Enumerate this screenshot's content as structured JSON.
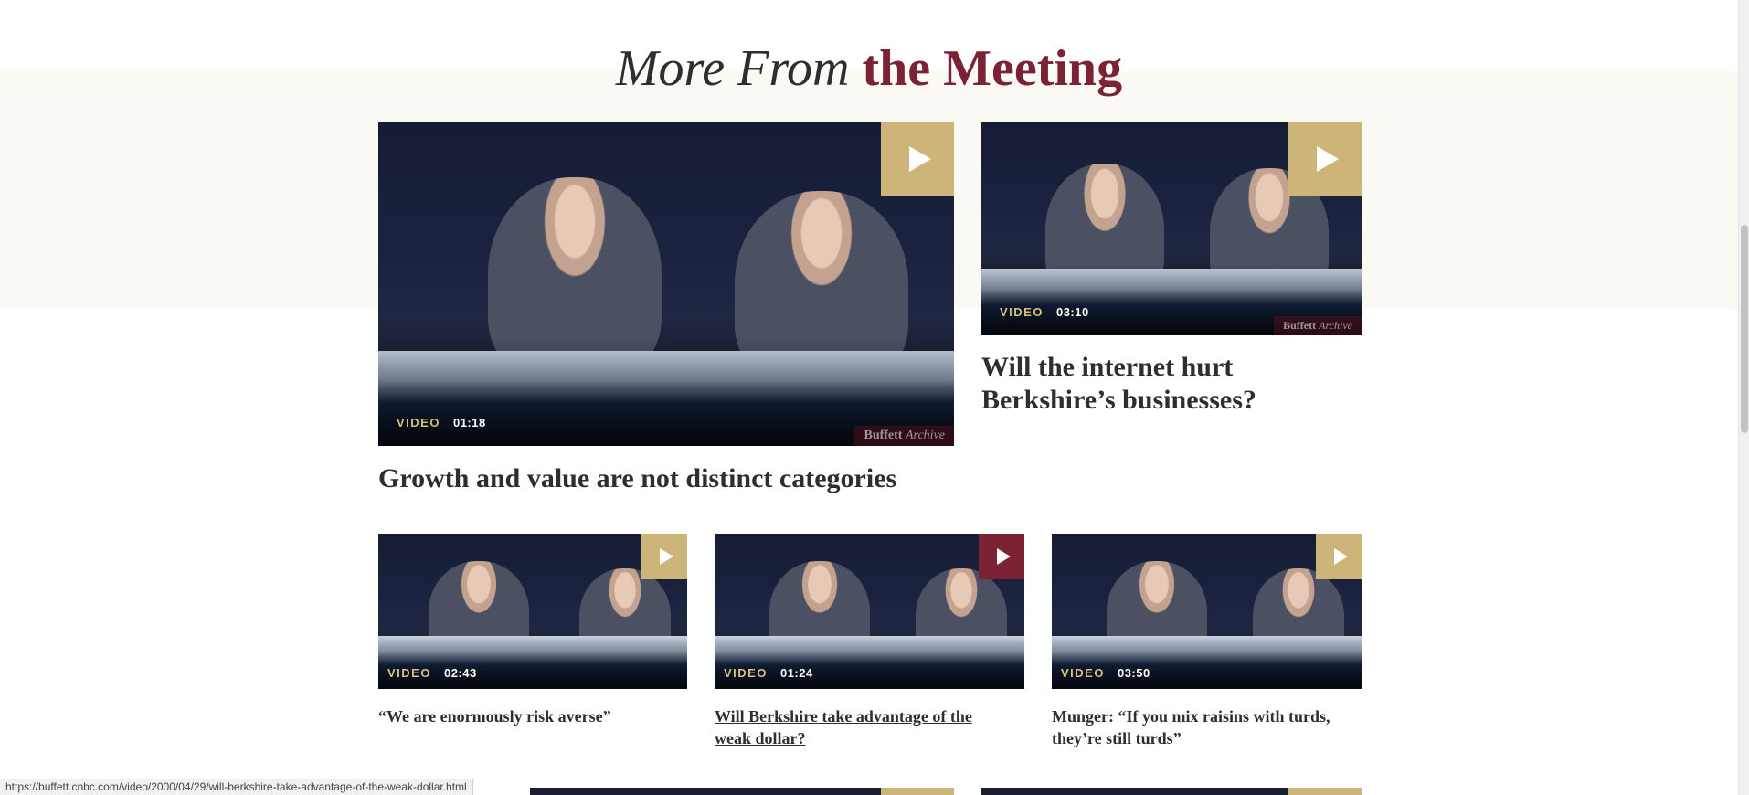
{
  "section": {
    "title_light": "More From",
    "title_bold": "the Meeting"
  },
  "colors": {
    "accent_maroon": "#7b2334",
    "play_gold": "#cdb57a",
    "play_active": "#7b2334",
    "band_beige": "#fbf9f4"
  },
  "featured": [
    {
      "label": "VIDEO",
      "duration": "01:18",
      "title": "Growth and value are not distinct categories",
      "watermark_a": "Buffett",
      "watermark_b": "Archive",
      "icon": "play-icon"
    },
    {
      "label": "VIDEO",
      "duration": "03:10",
      "title": "Will the internet hurt Berkshire’s businesses?",
      "watermark_a": "Buffett",
      "watermark_b": "Archive",
      "icon": "play-icon"
    }
  ],
  "grid": [
    {
      "label": "VIDEO",
      "duration": "02:43",
      "title": "“We are enormously risk averse”",
      "icon": "play-icon"
    },
    {
      "label": "VIDEO",
      "duration": "01:24",
      "title": "Will Berkshire take advantage of the weak dollar?",
      "icon": "play-icon",
      "hovered": true
    },
    {
      "label": "VIDEO",
      "duration": "03:50",
      "title": "Munger: “If you mix raisins with turds, they’re still turds”",
      "icon": "play-icon"
    }
  ],
  "status_bar": {
    "url": "https://buffett.cnbc.com/video/2000/04/29/will-berkshire-take-advantage-of-the-weak-dollar.html"
  }
}
